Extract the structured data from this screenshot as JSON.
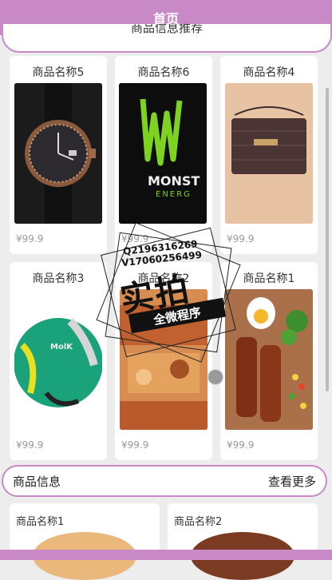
{
  "header": {
    "title": "首页"
  },
  "section_title": "商品信息推荐",
  "products": [
    {
      "name": "商品名称5",
      "price": "¥99.9",
      "image": "watch"
    },
    {
      "name": "商品名称6",
      "price": "¥99.9",
      "image": "monster-energy"
    },
    {
      "name": "商品名称4",
      "price": "¥99.9",
      "image": "handbag"
    },
    {
      "name": "商品名称3",
      "price": "¥99.9",
      "image": "soccer-ball"
    },
    {
      "name": "商品名称2",
      "price": "¥99.9",
      "image": "fried-food"
    },
    {
      "name": "商品名称1",
      "price": "¥99.9",
      "image": "skewers-meal"
    }
  ],
  "info_bar": {
    "title": "商品信息",
    "more": "查看更多"
  },
  "bottom_products": [
    {
      "name": "商品名称1"
    },
    {
      "name": "商品名称2"
    }
  ],
  "watermark": {
    "line1": "Q2196316269",
    "line2": "V17060256499",
    "big": "实拍",
    "ribbon": "全微程序"
  },
  "monster_text": {
    "brand": "MONST",
    "sub": "ENERG"
  },
  "colors": {
    "accent": "#c988c6",
    "background": "#ededed",
    "price": "#999999"
  }
}
